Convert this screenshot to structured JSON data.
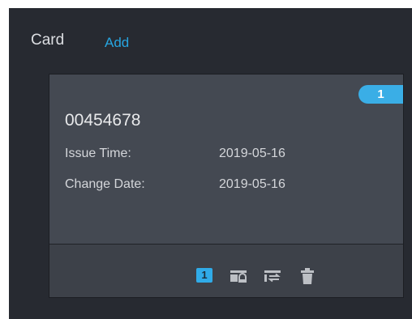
{
  "header": {
    "title": "Card",
    "add_label": "Add"
  },
  "card": {
    "badge": "1",
    "number": "00454678",
    "issue_time_label": "Issue Time:",
    "issue_time_value": "2019-05-16",
    "change_date_label": "Change Date:",
    "change_date_value": "2019-05-16",
    "actions": {
      "primary_card_label": "1",
      "icons": [
        "primary-card-icon",
        "card-loss-icon",
        "card-replace-icon",
        "delete-icon"
      ]
    }
  },
  "colors": {
    "panel_bg": "#272a31",
    "card_bg": "#444952",
    "footer_bg": "#3d4149",
    "accent": "#3aaee6",
    "link": "#27a5e0",
    "icon_gray": "#bdc0c5"
  }
}
